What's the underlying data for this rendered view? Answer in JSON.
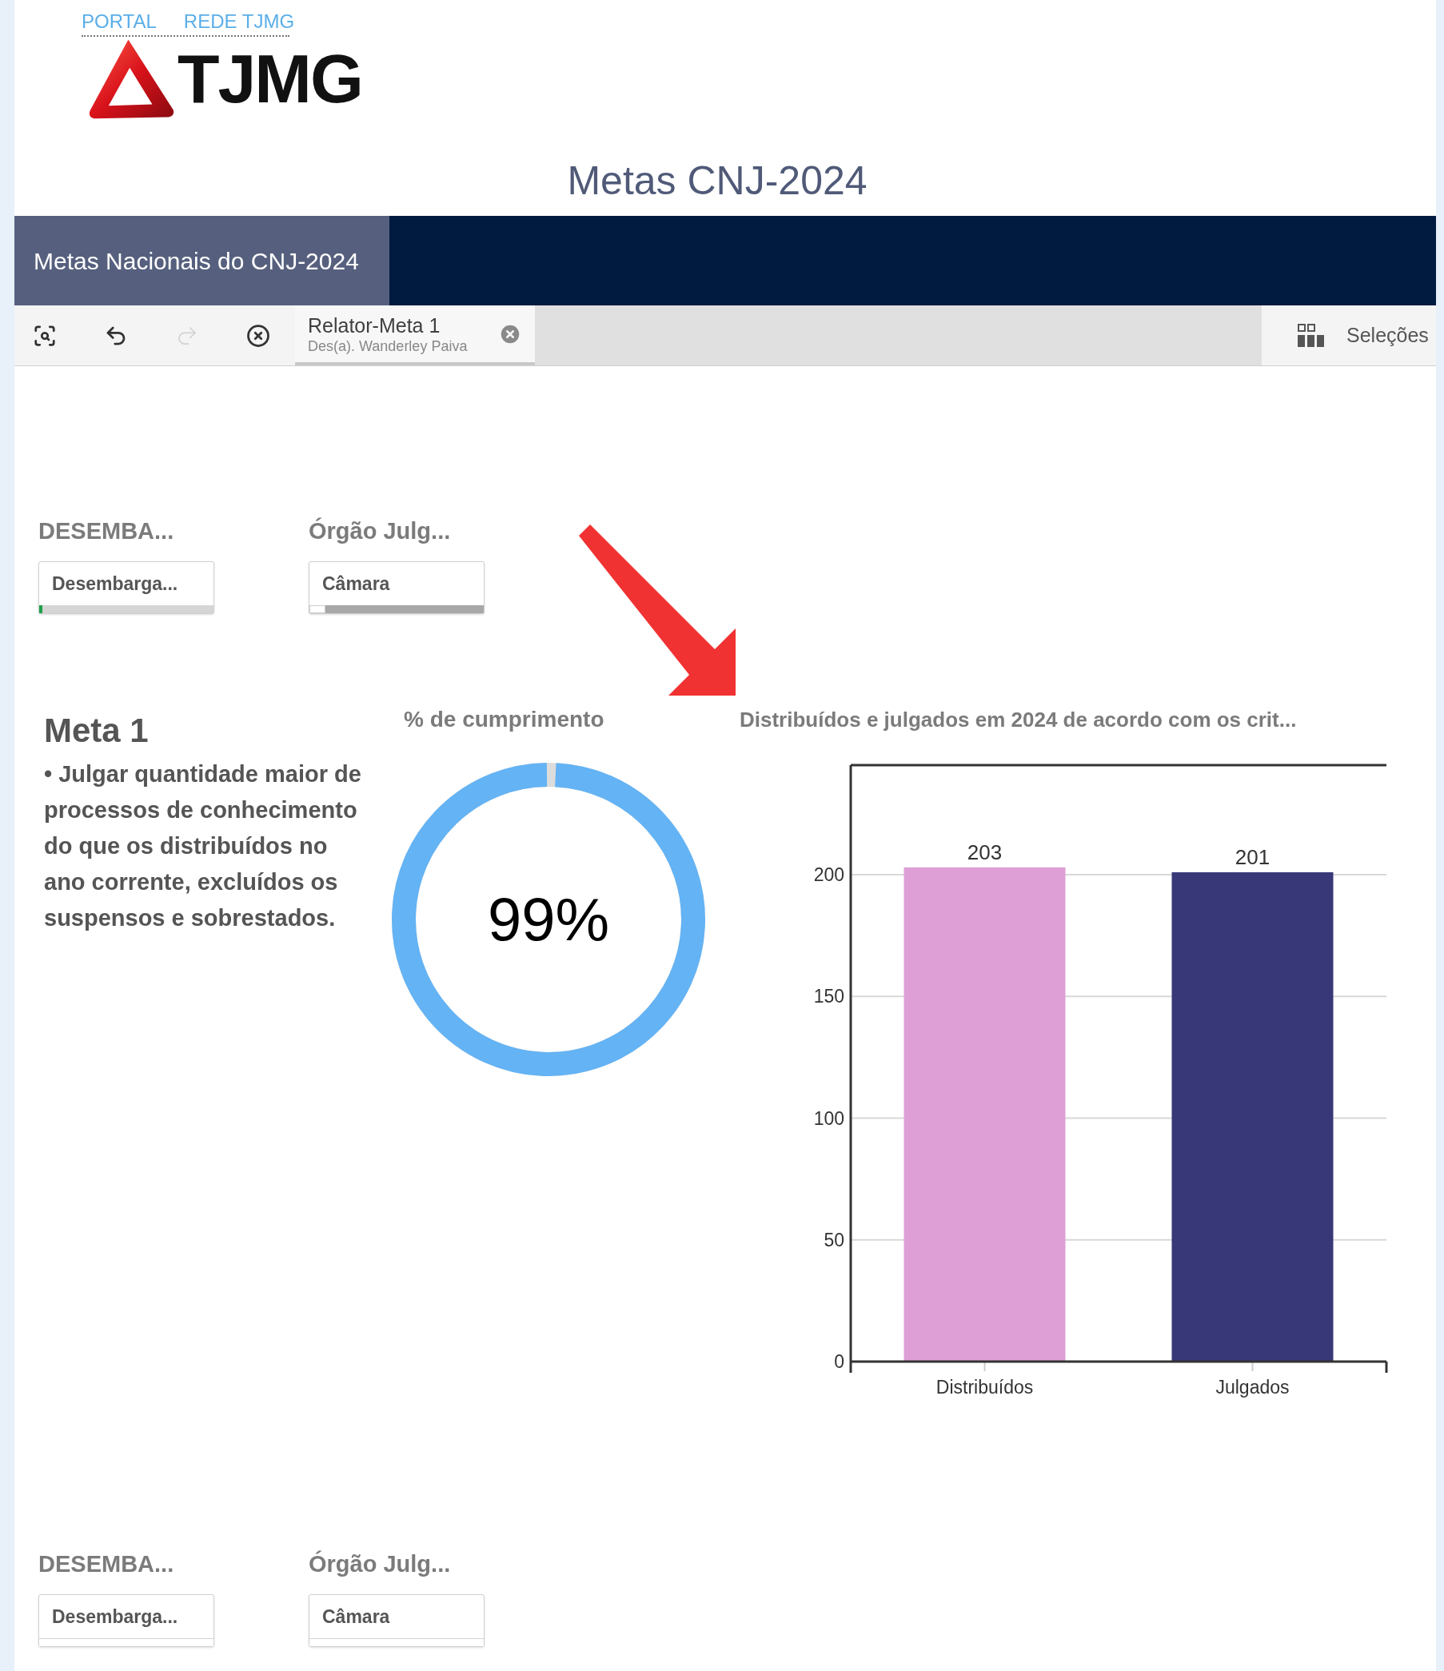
{
  "header": {
    "links": [
      "PORTAL",
      "REDE TJMG"
    ],
    "logo_text": "TJMG",
    "title": "Metas CNJ-2024"
  },
  "nav": {
    "items": [
      {
        "label": "Metas Nacionais do CNJ-2024",
        "selected": true
      }
    ]
  },
  "toolbar": {
    "buttons": [
      {
        "kind": "search",
        "disabled": false
      },
      {
        "kind": "back",
        "disabled": false
      },
      {
        "kind": "forward",
        "disabled": true
      },
      {
        "kind": "clear",
        "disabled": false
      }
    ],
    "selection_tab": {
      "title": "Relator-Meta 1",
      "subtitle": "Des(a). Wanderley Paiva"
    },
    "selections_label": "Seleções"
  },
  "filters_top": [
    {
      "label": "DESEMBA...",
      "value": "Desembarga...",
      "kind": "selected"
    },
    {
      "label": "Órgão Julg...",
      "value": "Câmara",
      "kind": "alternative"
    }
  ],
  "meta": {
    "title": "Meta 1",
    "text": "• Julgar quantidade maior de processos de conhecimento do que os distribuídos no ano corrente, excluídos os suspensos e sobrestados."
  },
  "gauge": {
    "title": "% de cumprimento",
    "value": "99%"
  },
  "bar_chart": {
    "title": "Distribuídos e julgados em 2024 de acordo com os crit...",
    "chart_data": {
      "type": "bar",
      "categories": [
        "Distribuídos",
        "Julgados"
      ],
      "values": [
        203,
        201
      ],
      "grid": true,
      "colors": [
        "#dd9fd6",
        "#383878"
      ],
      "ylim": [
        0,
        245
      ],
      "yticks": [
        0,
        50,
        100,
        150,
        200
      ],
      "data_labels": true
    }
  },
  "filters_bottom": [
    {
      "label": "DESEMBA...",
      "value": "Desembarga...",
      "kind": "plain"
    },
    {
      "label": "Órgão Julg...",
      "value": "Câmara",
      "kind": "plain"
    }
  ]
}
